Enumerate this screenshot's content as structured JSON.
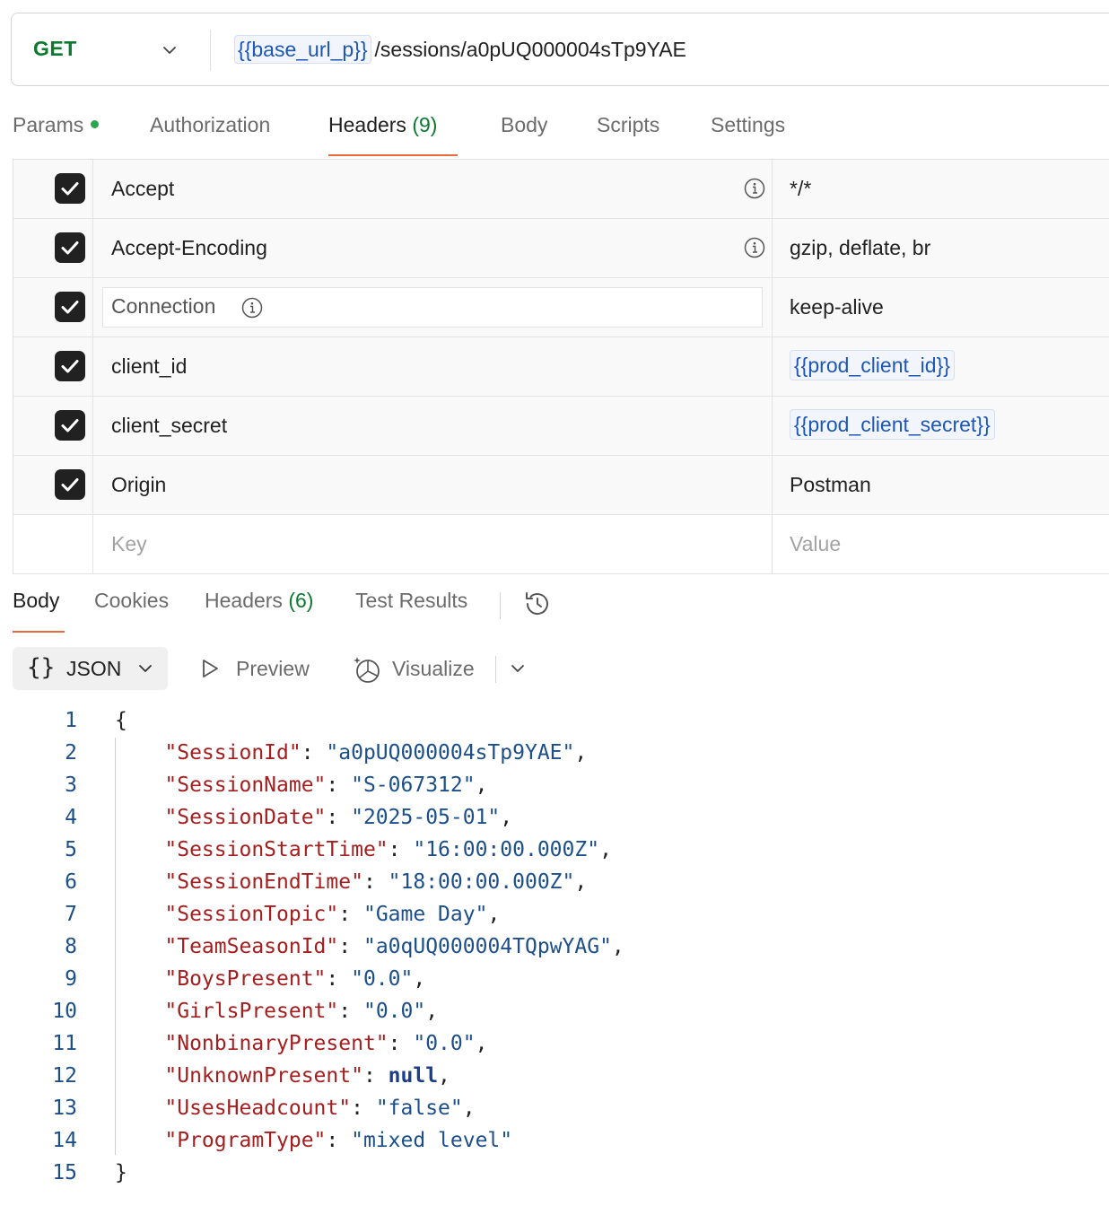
{
  "request": {
    "method": "GET",
    "url_variable": "{{base_url_p}}",
    "url_path": "/sessions/a0pUQ000004sTp9YAE"
  },
  "request_tabs": {
    "params": "Params",
    "authorization": "Authorization",
    "headers": "Headers",
    "headers_count": "(9)",
    "body": "Body",
    "scripts": "Scripts",
    "settings": "Settings"
  },
  "headers": [
    {
      "key": "Accept",
      "value": "*/*"
    },
    {
      "key": "Accept-Encoding",
      "value": "gzip, deflate, br"
    },
    {
      "key": "Connection",
      "value": "keep-alive"
    },
    {
      "key": "client_id",
      "value": "{{prod_client_id}}"
    },
    {
      "key": "client_secret",
      "value": "{{prod_client_secret}}"
    },
    {
      "key": "Origin",
      "value": "Postman"
    }
  ],
  "headers_new_row": {
    "key_placeholder": "Key",
    "value_placeholder": "Value"
  },
  "response_tabs": {
    "body": "Body",
    "cookies": "Cookies",
    "headers": "Headers",
    "headers_count": "(6)",
    "test_results": "Test Results"
  },
  "response_toolbar": {
    "format": "JSON",
    "preview": "Preview",
    "visualize": "Visualize"
  },
  "response_json": {
    "open_brace": "{",
    "close_brace": "}",
    "fields": [
      {
        "key": "\"SessionId\"",
        "value": "\"a0pUQ000004sTp9YAE\"",
        "sep": ","
      },
      {
        "key": "\"SessionName\"",
        "value": "\"S-067312\"",
        "sep": ","
      },
      {
        "key": "\"SessionDate\"",
        "value": "\"2025-05-01\"",
        "sep": ","
      },
      {
        "key": "\"SessionStartTime\"",
        "value": "\"16:00:00.000Z\"",
        "sep": ","
      },
      {
        "key": "\"SessionEndTime\"",
        "value": "\"18:00:00.000Z\"",
        "sep": ","
      },
      {
        "key": "\"SessionTopic\"",
        "value": "\"Game Day\"",
        "sep": ","
      },
      {
        "key": "\"TeamSeasonId\"",
        "value": "\"a0qUQ000004TQpwYAG\"",
        "sep": ","
      },
      {
        "key": "\"BoysPresent\"",
        "value": "\"0.0\"",
        "sep": ","
      },
      {
        "key": "\"GirlsPresent\"",
        "value": "\"0.0\"",
        "sep": ","
      },
      {
        "key": "\"NonbinaryPresent\"",
        "value": "\"0.0\"",
        "sep": ","
      },
      {
        "key": "\"UnknownPresent\"",
        "value": "null",
        "sep": ","
      },
      {
        "key": "\"UsesHeadcount\"",
        "value": "\"false\"",
        "sep": ","
      },
      {
        "key": "\"ProgramType\"",
        "value": "\"mixed level\"",
        "sep": ""
      }
    ],
    "line_numbers": [
      "1",
      "2",
      "3",
      "4",
      "5",
      "6",
      "7",
      "8",
      "9",
      "10",
      "11",
      "12",
      "13",
      "14",
      "15"
    ]
  }
}
